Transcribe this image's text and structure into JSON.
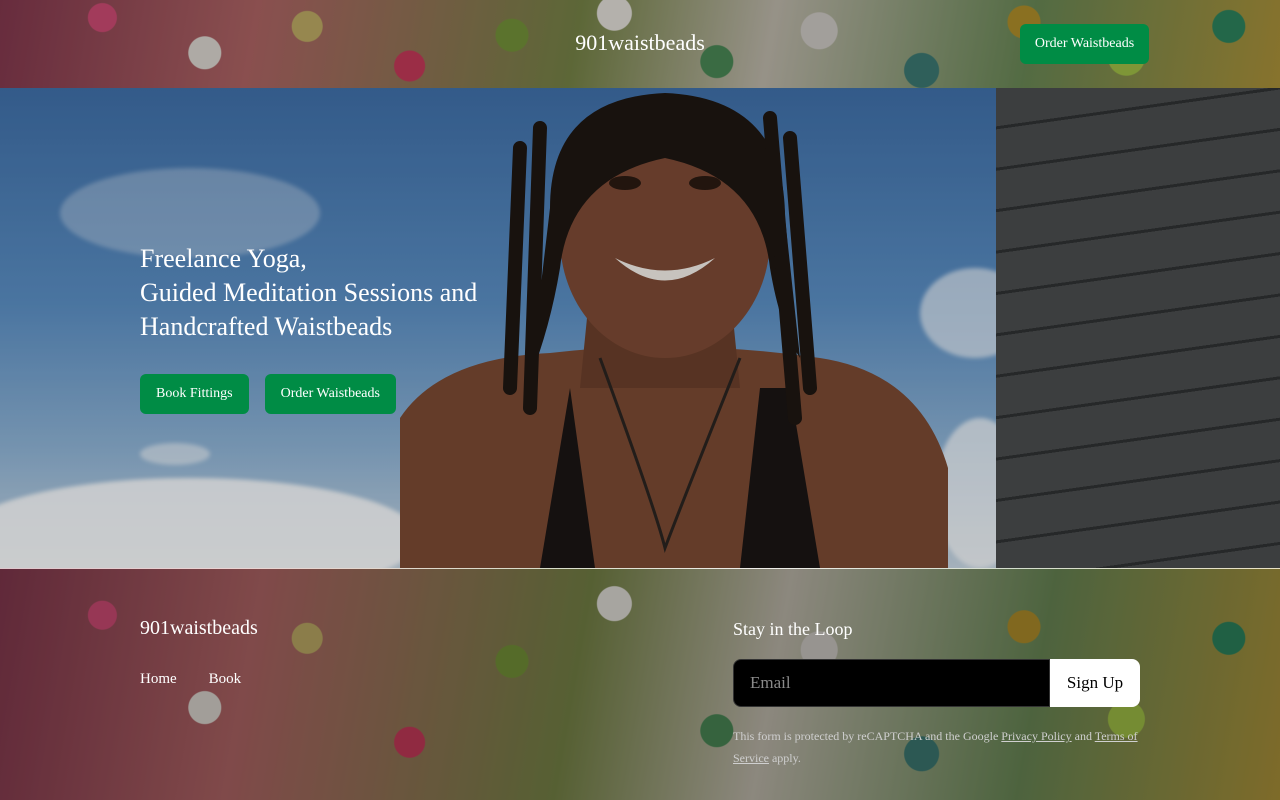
{
  "header": {
    "site_title": "901waistbeads",
    "order_button": "Order Waistbeads"
  },
  "hero": {
    "heading_lines": [
      "Freelance Yoga,",
      "Guided Meditation Sessions and",
      "Handcrafted Waistbeads"
    ],
    "book_button": "Book Fittings",
    "order_button": "Order Waistbeads"
  },
  "footer": {
    "brand": "901waistbeads",
    "nav": [
      {
        "label": "Home"
      },
      {
        "label": "Book"
      }
    ],
    "newsletter": {
      "title": "Stay in the Loop",
      "email_placeholder": "Email",
      "signup_label": "Sign Up",
      "legal_prefix": "This form is protected by reCAPTCHA and the Google ",
      "privacy_link": "Privacy Policy",
      "legal_and": " and ",
      "terms_link": "Terms of Service",
      "legal_suffix": " apply."
    }
  },
  "colors": {
    "accent_green": "#008c45",
    "signup_button": "#ffffff",
    "email_field": "#000000"
  }
}
